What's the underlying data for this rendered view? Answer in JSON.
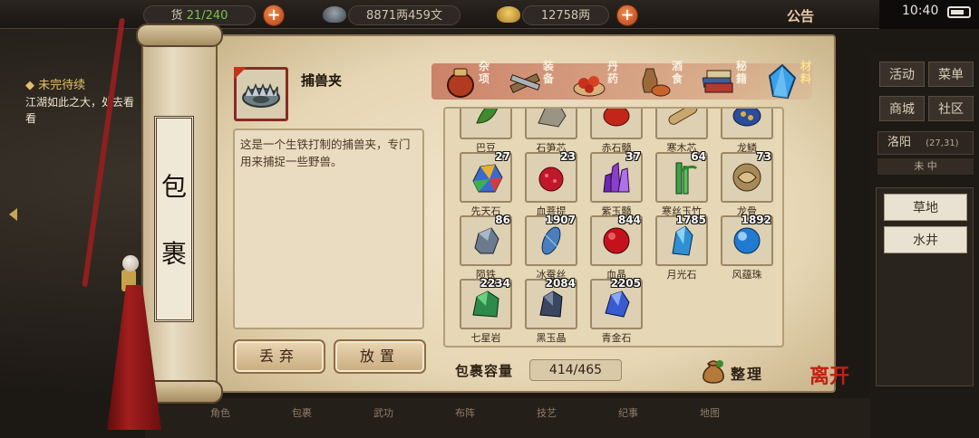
{
  "top_bar": {
    "stat1": {
      "label": "货",
      "value": "21/240"
    },
    "money": "8871两459文",
    "ingot": "12758两",
    "notice": "公告",
    "time": "10:40"
  },
  "left_quest": {
    "title": "未完待续",
    "text": "江湖如此之大，处去看看"
  },
  "right_panel": {
    "buttons": [
      "活动",
      "菜单",
      "商城",
      "社区"
    ],
    "location": "洛阳",
    "coords": "(27,31)",
    "compass": "未 中",
    "list": [
      "草地",
      "水井"
    ]
  },
  "bottom_tabs": [
    "角色",
    "包裹",
    "武功",
    "布阵",
    "技艺",
    "纪事",
    "地图"
  ],
  "scroll": {
    "title_chars": [
      "包",
      "裹"
    ]
  },
  "item": {
    "name": "捕兽夹",
    "description": "这是一个生铁打制的捕兽夹，专门用来捕捉一些野兽。"
  },
  "actions": {
    "discard": "丢弃",
    "place": "放置"
  },
  "categories": [
    {
      "label": "杂项",
      "icon": "jar-icon",
      "active": false
    },
    {
      "label": "装备",
      "icon": "weapons-icon",
      "active": false
    },
    {
      "label": "丹药",
      "icon": "pills-icon",
      "active": false
    },
    {
      "label": "酒食",
      "icon": "wine-food-icon",
      "active": false
    },
    {
      "label": "秘籍",
      "icon": "books-icon",
      "active": false
    },
    {
      "label": "材料",
      "icon": "crystal-icon",
      "active": true
    }
  ],
  "items": [
    {
      "name": "巴豆",
      "qty": "",
      "icon": "leaf-icon",
      "color": "#3f8a2c"
    },
    {
      "name": "石笋芯",
      "qty": "",
      "icon": "stone-icon",
      "color": "#9a9485"
    },
    {
      "name": "赤石髓",
      "qty": "",
      "icon": "red-ore-icon",
      "color": "#c2261a"
    },
    {
      "name": "寒木芯",
      "qty": "",
      "icon": "wood-icon",
      "color": "#c8a870"
    },
    {
      "name": "龙鳞",
      "qty": "",
      "icon": "scale-icon",
      "color": "#2b4c9a"
    },
    {
      "name": "先天石",
      "qty": "27",
      "icon": "rainbow-stone-icon",
      "color": "#d08a3a"
    },
    {
      "name": "血菩提",
      "qty": "23",
      "icon": "red-berry-icon",
      "color": "#c0172a"
    },
    {
      "name": "紫玉髓",
      "qty": "37",
      "icon": "purple-crystal-icon",
      "color": "#8a3fc9"
    },
    {
      "name": "寒丝玉竹",
      "qty": "64",
      "icon": "bamboo-icon",
      "color": "#3fa04a"
    },
    {
      "name": "龙骨",
      "qty": "73",
      "icon": "dragon-bone-icon",
      "color": "#a88a5a"
    },
    {
      "name": "陨铁",
      "qty": "86",
      "icon": "meteor-iron-icon",
      "color": "#6b7a8c"
    },
    {
      "name": "冰蚕丝",
      "qty": "1907",
      "icon": "silk-icon",
      "color": "#4a7fbf"
    },
    {
      "name": "血晶",
      "qty": "844",
      "icon": "blood-crystal-icon",
      "color": "#c4121d"
    },
    {
      "name": "月光石",
      "qty": "1785",
      "icon": "moonstone-icon",
      "color": "#2f8fd0"
    },
    {
      "name": "风蕴珠",
      "qty": "1892",
      "icon": "wind-pearl-icon",
      "color": "#1f7ad0"
    },
    {
      "name": "七星岩",
      "qty": "2234",
      "icon": "green-rock-icon",
      "color": "#2e8a4a"
    },
    {
      "name": "黑玉晶",
      "qty": "2084",
      "icon": "black-jade-icon",
      "color": "#3b4660"
    },
    {
      "name": "青金石",
      "qty": "2205",
      "icon": "lapis-icon",
      "color": "#3a5ad0"
    }
  ],
  "capacity": {
    "label": "包裹容量",
    "value": "414/465"
  },
  "sort_label": "整理",
  "leave_label": "离开"
}
